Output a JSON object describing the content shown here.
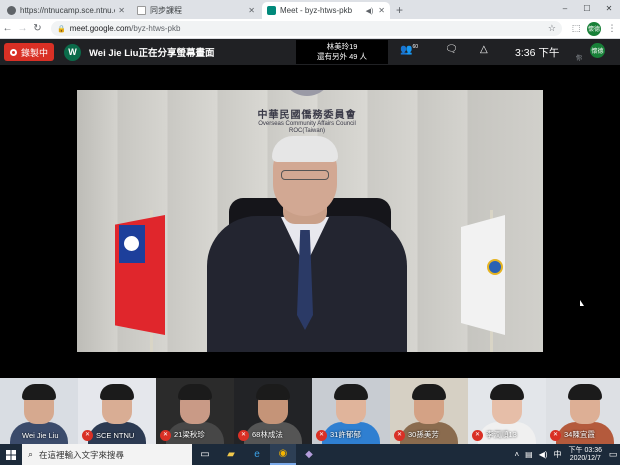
{
  "browser": {
    "tabs": [
      {
        "title": "https://ntnucamp.sce.ntnu.edu",
        "active": false,
        "favicon_color": "#5f6368"
      },
      {
        "title": "同步課程",
        "active": false,
        "favicon_color": "#ffffff"
      },
      {
        "title": "Meet - byz-htws-pkb",
        "active": true,
        "favicon_color": "#00897b"
      }
    ],
    "new_tab": "+",
    "address": {
      "host": "meet.google.com",
      "path": "/byz-htws-pkb"
    },
    "profile_initials": "懷德",
    "window_controls": [
      "–",
      "☐",
      "✕"
    ]
  },
  "meet": {
    "recording_label": "錄製中",
    "presenter_initial": "W",
    "presenting_text": "Wei Jie Liu正在分享螢幕畫面",
    "toast_line1": "林美玲19",
    "toast_line2": "還有另外 49 人",
    "people_count": "60",
    "clock": "3:36 下午",
    "account_initials": "懷德",
    "hint": "你",
    "accent_red": "#d93025"
  },
  "main_video": {
    "sign_zh": "中華民國僑務委員會",
    "sign_en1": "Overseas Community Affairs Council",
    "sign_en2": "ROC(Taiwan)"
  },
  "participants": [
    {
      "name": "Wei Jie Liu",
      "muted": false,
      "bg": "#d9dde3",
      "skin": "#d6a98f",
      "shirt": "#3b4b6b"
    },
    {
      "name": "SCE NTNU",
      "muted": true,
      "bg": "#e5e7ec",
      "skin": "#d9ad94",
      "shirt": "#2c3a52"
    },
    {
      "name": "21梁秋珍",
      "muted": true,
      "bg": "#2b2b2b",
      "skin": "#c99a86",
      "shirt": "#474747"
    },
    {
      "name": "68林成法",
      "muted": true,
      "bg": "#222326",
      "skin": "#c59478",
      "shirt": "#555"
    },
    {
      "name": "31許郁郁",
      "muted": true,
      "bg": "#c8ccd2",
      "skin": "#e0b49b",
      "shirt": "#2f7fd1"
    },
    {
      "name": "30孫美芳",
      "muted": true,
      "bg": "#d6d0c4",
      "skin": "#d4a285",
      "shirt": "#8a6b4e"
    },
    {
      "name": "李潤順13",
      "muted": true,
      "bg": "#e3e6ea",
      "skin": "#e6bea8",
      "shirt": "#f0f0f0"
    },
    {
      "name": "34陳宜霞",
      "muted": true,
      "bg": "#dde0e4",
      "skin": "#ddaf95",
      "shirt": "#b45a3c"
    }
  ],
  "taskbar": {
    "search_placeholder": "在這裡輸入文字來搜尋",
    "time": "下午 03:36",
    "date": "2020/12/7",
    "lang": "中"
  }
}
